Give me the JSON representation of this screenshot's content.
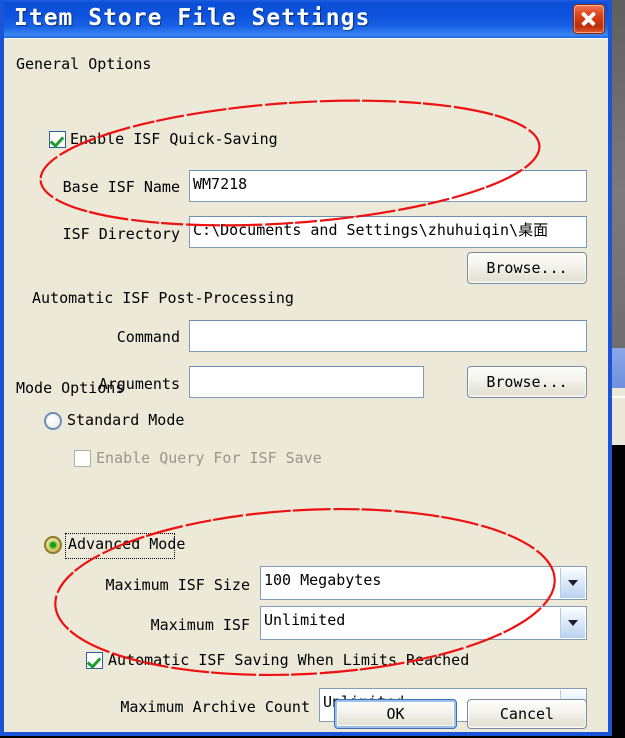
{
  "window": {
    "title": "Item Store File Settings",
    "close_icon": "close-icon"
  },
  "sections": {
    "general": "General Options",
    "postprocessing": "Automatic ISF Post-Processing",
    "mode": "Mode Options"
  },
  "general": {
    "enable_quick_saving": {
      "label": "Enable ISF Quick-Saving",
      "checked": true
    },
    "base_isf_name": {
      "label": "Base ISF Name",
      "value": "WM7218"
    },
    "isf_directory": {
      "label": "ISF Directory",
      "value": "C:\\Documents and Settings\\zhuhuiqin\\桌面"
    },
    "browse_label": "Browse..."
  },
  "postprocessing": {
    "command": {
      "label": "Command",
      "value": "",
      "placeholder": ""
    },
    "arguments": {
      "label": "Arguments",
      "value": "",
      "placeholder": ""
    },
    "browse_label": "Browse..."
  },
  "mode": {
    "standard": {
      "label": "Standard Mode",
      "selected": false
    },
    "enable_query": {
      "label": "Enable Query For ISF Save",
      "checked": false,
      "disabled": true
    },
    "advanced": {
      "label": "Advanced Mode",
      "selected": true,
      "focused": true
    },
    "max_isf_size": {
      "label": "Maximum ISF Size",
      "value": "100 Megabytes"
    },
    "max_isf": {
      "label": "Maximum ISF",
      "value": "Unlimited"
    },
    "auto_saving": {
      "label": "Automatic ISF Saving When Limits Reached",
      "checked": true
    },
    "max_archive_count": {
      "label": "Maximum Archive Count",
      "value": "Unlimited"
    }
  },
  "footer": {
    "ok_label": "OK",
    "cancel_label": "Cancel"
  },
  "colors": {
    "titlebar": "#0d52dd",
    "client": "#ece9d8",
    "annotation": "#ee1111",
    "accent_check": "#1f9b32"
  },
  "annotations": {
    "ellipse_top": "hand-drawn red ellipse around Base ISF Name and ISF Directory fields",
    "ellipse_bottom": "hand-drawn red ellipse around Advanced Mode limits settings"
  }
}
